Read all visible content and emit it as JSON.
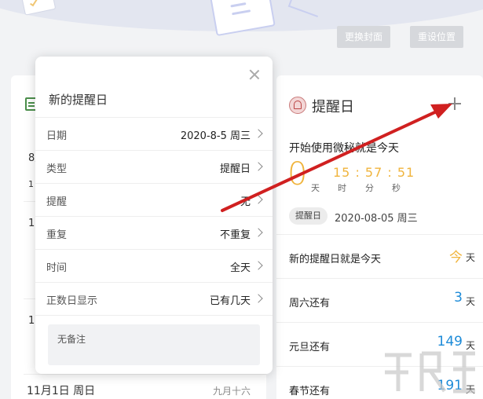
{
  "toolbar": {
    "change_cover_label": "更换封面",
    "reset_position_label": "重设位置"
  },
  "left_panel": {
    "fragments": [
      "8月",
      "1",
      "10",
      "10"
    ],
    "bottom_date": "11月1日 周日",
    "bottom_lunar": "九月十六"
  },
  "popup": {
    "title": "新的提醒日",
    "rows": [
      {
        "label": "日期",
        "value": "2020-8-5 周三"
      },
      {
        "label": "类型",
        "value": "提醒日"
      },
      {
        "label": "提醒",
        "value": "无"
      },
      {
        "label": "重复",
        "value": "不重复"
      },
      {
        "label": "时间",
        "value": "全天"
      },
      {
        "label": "正数日显示",
        "value": "已有几天"
      }
    ],
    "note_placeholder": "无备注"
  },
  "right_panel": {
    "title": "提醒日",
    "event_title": "开始使用微秘就是今天",
    "days": "0",
    "day_unit": "天",
    "timer": "15 : 57 : 51",
    "time_units": [
      "时",
      "分",
      "秒"
    ],
    "tag": "提醒日",
    "date": "2020-08-05 周三",
    "countdowns": [
      {
        "name": "新的提醒日就是今天",
        "num": "今",
        "unit": "天"
      },
      {
        "name": "周六还有",
        "num": "3",
        "unit": "天"
      },
      {
        "name": "元旦还有",
        "num": "149",
        "unit": "天"
      },
      {
        "name": "春节还有",
        "num": "191",
        "unit": "天"
      }
    ]
  },
  "colors": {
    "accent_gold": "#f0b43c",
    "accent_blue": "#1d8bd8",
    "annotation_arrow": "#d02020"
  }
}
